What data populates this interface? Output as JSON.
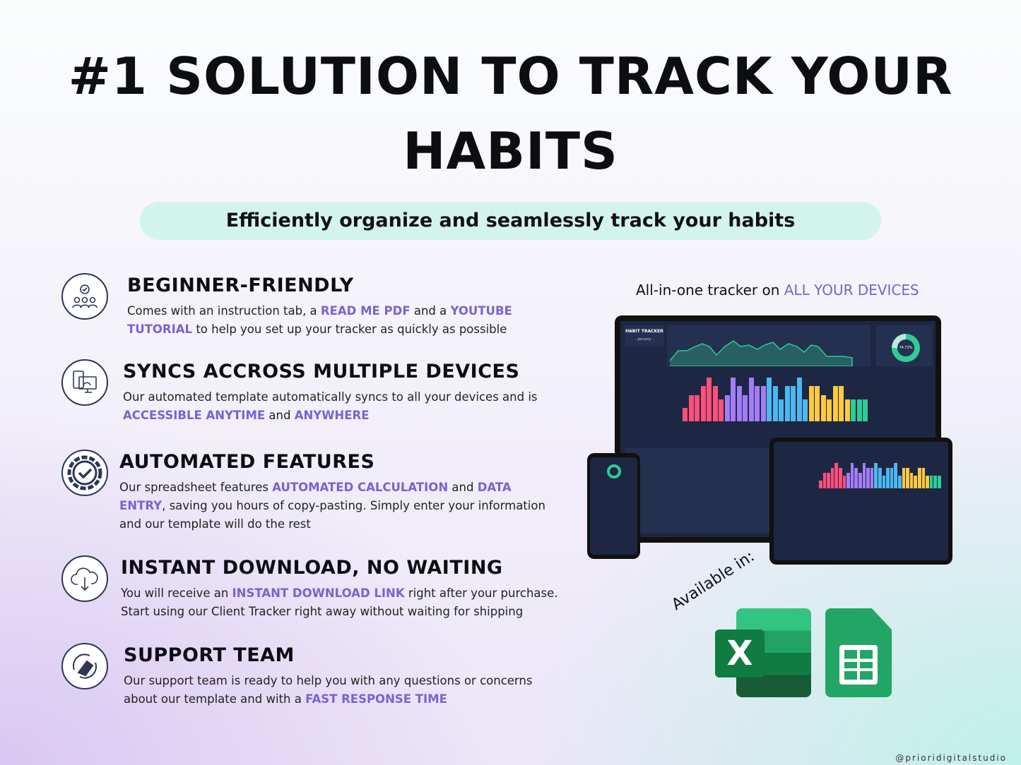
{
  "title": {
    "line1": "#1 SOLUTION TO TRACK YOUR",
    "line2": "HABITS"
  },
  "subtitle": "Efficiently organize and seamlessly track your habits",
  "highlight_color": "#7b62d0",
  "features": [
    {
      "icon": "gear-team-icon",
      "heading": "BEGINNER-FRIENDLY",
      "desc": [
        {
          "t": "Comes with an instruction tab, a "
        },
        {
          "t": "READ ME PDF",
          "hl": true
        },
        {
          "t": " and a "
        },
        {
          "t": "YOUTUBE TUTORIAL",
          "hl": true
        },
        {
          "t": " to help you set up your tracker as quickly as possible"
        }
      ]
    },
    {
      "icon": "devices-sync-icon",
      "heading": "SYNCS ACCROSS MULTIPLE DEVICES",
      "desc": [
        {
          "t": "Our automated template automatically syncs to all your devices and is "
        },
        {
          "t": "ACCESSIBLE ANYTIME",
          "hl": true
        },
        {
          "t": " and "
        },
        {
          "t": "ANYWHERE",
          "hl": true
        }
      ]
    },
    {
      "icon": "gear-check-icon",
      "heading": "AUTOMATED FEATURES",
      "desc": [
        {
          "t": "Our spreadsheet features "
        },
        {
          "t": "AUTOMATED CALCULATION",
          "hl": true
        },
        {
          "t": " and "
        },
        {
          "t": "DATA ENTRY",
          "hl": true
        },
        {
          "t": ", saving you hours of copy-pasting. Simply enter your information and our template will do the rest"
        }
      ]
    },
    {
      "icon": "cloud-download-icon",
      "heading": "INSTANT DOWNLOAD, NO WAITING",
      "desc": [
        {
          "t": "You will receive an "
        },
        {
          "t": "INSTANT DOWNLOAD LINK",
          "hl": true
        },
        {
          "t": " right after your purchase. Start using our Client Tracker right away without waiting for shipping"
        }
      ]
    },
    {
      "icon": "handshake-support-icon",
      "heading": "SUPPORT TEAM",
      "desc": [
        {
          "t": "Our support team is ready to help you with any questions or concerns about our template and with a "
        },
        {
          "t": "FAST RESPONSE TIME",
          "hl": true
        }
      ]
    }
  ],
  "devices": {
    "prefix": "All-in-one tracker on ",
    "highlight": "ALL YOUR DEVICES"
  },
  "mockup": {
    "title": "HABIT TRACKER",
    "month": "- January -",
    "progress": "74.73%"
  },
  "available": "Available in:",
  "apps": [
    {
      "name": "excel-icon",
      "letter": "X",
      "color": "#1f7244"
    },
    {
      "name": "google-sheets-icon",
      "color": "#1e8e4e"
    }
  ],
  "watermark": "@prioridigitalstudio"
}
